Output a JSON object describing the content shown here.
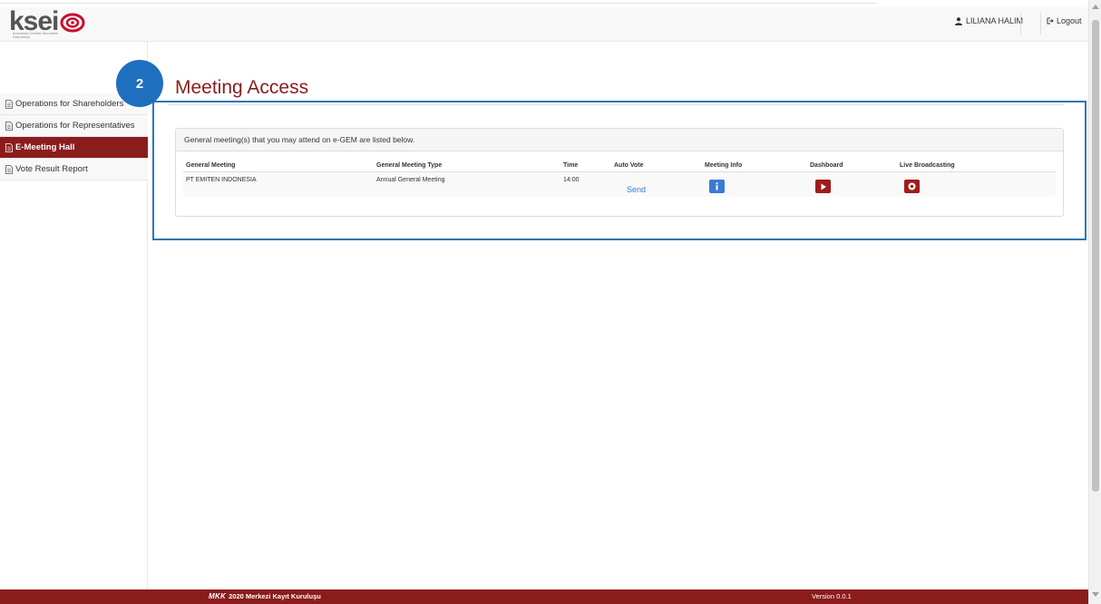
{
  "header": {
    "logo_text": "ksei",
    "logo_subtitle": "Indonesia Central Securities Depository",
    "user_name": "LILIANA HALIM",
    "logout_label": "Logout"
  },
  "badge": {
    "number": "2"
  },
  "sidebar": {
    "items": [
      {
        "label": "Operations for Shareholders",
        "active": false
      },
      {
        "label": "Operations for Representatives",
        "active": false
      },
      {
        "label": "E-Meeting Hall",
        "active": true
      },
      {
        "label": "Vote Result Report",
        "active": false
      }
    ]
  },
  "main": {
    "title": "Meeting Access",
    "panel_heading": "General meeting(s) that you may attend on e-GEM are listed below.",
    "table": {
      "columns": [
        "General Meeting",
        "General Meeting Type",
        "Time",
        "Auto Vote",
        "Meeting Info",
        "Dashboard",
        "Live Broadcasting"
      ],
      "rows": [
        {
          "general_meeting": "PT EMITEN INDONESIA",
          "meeting_type": "Annual General Meeting",
          "time": "14:00",
          "auto_vote": "Send",
          "meeting_info_icon": "info-icon",
          "dashboard_icon": "play-icon",
          "live_icon": "record-icon"
        }
      ]
    }
  },
  "footer": {
    "brand": "MKK",
    "copyright": "2020 Merkezi Kayıt Kuruluşu",
    "version": "Version 0.0.1"
  },
  "colors": {
    "brand_red": "#8b1c1c",
    "button_red": "#a01c1c",
    "info_blue": "#3a7bd5",
    "highlight_blue": "#2e75b6",
    "badge_blue": "#1f6fbf"
  }
}
